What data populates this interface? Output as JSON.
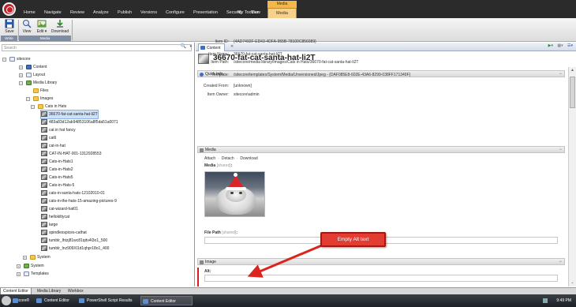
{
  "ribbon_tabs": [
    "Home",
    "Navigate",
    "Review",
    "Analyze",
    "Publish",
    "Versions",
    "Configure",
    "Presentation",
    "Security",
    "View",
    "My Toolbar"
  ],
  "contextual_tab": {
    "group": "Media",
    "tab": "Media"
  },
  "ribbon": {
    "save": "Save",
    "write_group": "Write",
    "view": "View",
    "edit": "Edit ▾",
    "download": "Download",
    "media_group": "Media"
  },
  "search": {
    "placeholder": "Search"
  },
  "tree": {
    "root": "sitecore",
    "content": "Content",
    "layout": "Layout",
    "media_library": "Media Library",
    "files": "Files",
    "images": "Images",
    "cats_in_hats": "Cats in Hats",
    "items": [
      "36670-fat-cat-santa-hat-li2T",
      "483a83d12ab94853106a8f5da51a0071",
      "cat in hat fancy",
      "cat6",
      "cat-in-hat",
      "CAT-IN-HAT-001-1312928553",
      "Cats-in-Hats1",
      "Cats-in-Hats2",
      "Cats-in-Hats5",
      "Cats-in-Hats-5",
      "cats-in-santa-hats-12102010-01",
      "cats-in-the-hats-15-amazing-pictures-9",
      "cat-wizard-hat01",
      "hellokittycat",
      "large",
      "spindlesspices-cathat",
      "tumblr_lhtzj81wc81qdv4l3o1_500",
      "tumblr_lnz909Xl1d1qhpr18o1_400"
    ],
    "system": "System",
    "system2": "System",
    "templates": "Templates"
  },
  "content_tab": "Content",
  "item_title": "36670-fat-cat-santa-hat-li2T",
  "quick_info": {
    "header": "Quick Info",
    "rows": [
      {
        "label": "Item ID:",
        "value": "{4AD7492F-ED43-4DFA-955B-78100C856089}"
      },
      {
        "label": "Item Name:",
        "value": "36670-fat-cat-santa-hat-li2T"
      },
      {
        "label": "Item Path:",
        "value": "/sitecore/media library/Images/Cats in Hats/36670-fat-cat-santa-hat-li2T"
      },
      {
        "label": "Template:",
        "value": "/sitecore/templates/System/Media/Unversioned/Jpeg -   {DAF085E8-602E-43A6-8299-038FF171349F}"
      },
      {
        "label": "Created From:",
        "value": "[unknown]"
      },
      {
        "label": "Item Owner:",
        "value": "sitecore\\admin"
      }
    ]
  },
  "media_section": {
    "header": "Media",
    "attach": "Attach",
    "detach": "Detach",
    "download": "Download",
    "media_label": "Media",
    "shared": "[shared]",
    "file_path_label": "File Path",
    "file_path_shared": "[shared]",
    "colon": ":"
  },
  "image_section": {
    "header": "Image",
    "alt_label": "Alt:"
  },
  "callout": "Empty Alt text",
  "bottom_tabs": [
    "Content Editor",
    "Media Library",
    "Workbox"
  ],
  "taskbar": {
    "items": [
      "sitecore®",
      "Content Editor",
      "PowerShell Script Results",
      "Content Editor"
    ],
    "clock": "9:49 PM"
  },
  "colors": {
    "callout": "#e23c33",
    "accent": "#3d6fc4",
    "context_tab": "#f2b84b"
  }
}
